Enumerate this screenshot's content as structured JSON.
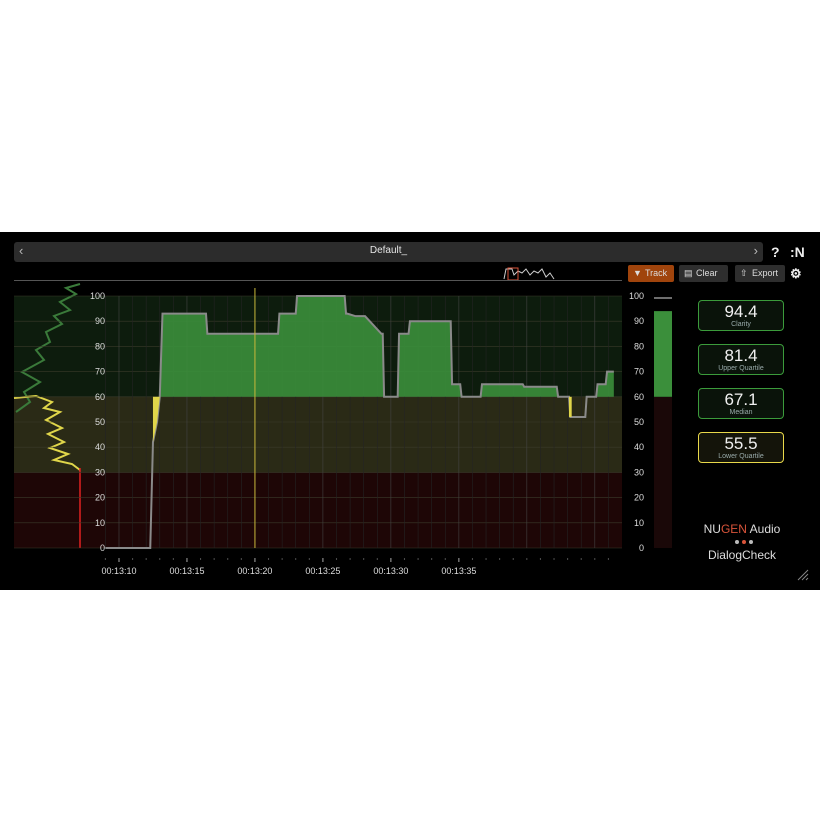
{
  "header": {
    "preset_name": "Default_",
    "help_label": "?",
    "logo_label": ":N"
  },
  "toolbar": {
    "track_label": "Track",
    "clear_label": "Clear",
    "export_label": "Export"
  },
  "colors": {
    "green_zone": "#3b8f3b",
    "yellow_zone": "#2a2a16",
    "red_zone": "#1e0606",
    "trace_yellow": "#e0d64a",
    "trace_grey": "#8a8a8a",
    "accent_orange": "#a0440c"
  },
  "chart_data": {
    "type": "area",
    "ylim": [
      0,
      100
    ],
    "y_ticks": [
      0,
      10,
      20,
      30,
      40,
      50,
      60,
      70,
      80,
      90,
      100
    ],
    "x_tick_labels": [
      "00:13:10",
      "00:13:15",
      "00:13:20",
      "00:13:25",
      "00:13:30",
      "00:13:35"
    ],
    "zones": [
      {
        "from": 0,
        "to": 30,
        "color": "red"
      },
      {
        "from": 30,
        "to": 60,
        "color": "yellow"
      },
      {
        "from": 60,
        "to": 100,
        "color": "green"
      }
    ],
    "series": [
      {
        "x": [
          0,
          3.3,
          3.5,
          3.8,
          4.0,
          4.2,
          7.4,
          7.5,
          9.2,
          9.3,
          12.7,
          12.8,
          14.0,
          14.1,
          17.6,
          17.7,
          17.8,
          18.4,
          18.5,
          19.0,
          19.1,
          20.3,
          20.4,
          20.5,
          21.5,
          21.6,
          22.3,
          22.4,
          25.4,
          25.5,
          26.1,
          26.2,
          27.6,
          27.7,
          30.7,
          30.8,
          33.2,
          33.3,
          34.1,
          34.2,
          35.3,
          35.4,
          36.1,
          36.2,
          36.8,
          36.9,
          37.4
        ],
        "y": [
          0,
          0,
          42,
          50,
          60,
          93,
          93,
          85,
          85,
          85,
          85,
          93,
          93,
          100,
          100,
          93,
          93,
          92,
          92,
          92,
          92,
          85,
          85,
          60,
          60,
          85,
          85,
          90,
          90,
          65,
          65,
          60,
          60,
          65,
          65,
          64,
          64,
          60,
          60,
          52,
          52,
          60,
          60,
          65,
          65,
          70,
          70
        ]
      }
    ],
    "playhead_x": 11.0,
    "right_meter": {
      "ticks": [
        0,
        10,
        20,
        30,
        40,
        50,
        60,
        70,
        80,
        90,
        100
      ],
      "level": 94
    }
  },
  "stats": [
    {
      "value": "94.4",
      "caption": "Clarity",
      "state": "green"
    },
    {
      "value": "81.4",
      "caption": "Upper Quartile",
      "state": "green"
    },
    {
      "value": "67.1",
      "caption": "Median",
      "state": "green"
    },
    {
      "value": "55.5",
      "caption": "Lower Quartile",
      "state": "yellow"
    }
  ],
  "brand": {
    "prefix": "NU",
    "highlight": "GEN",
    "suffix": " Audio",
    "product": "DialogCheck"
  }
}
